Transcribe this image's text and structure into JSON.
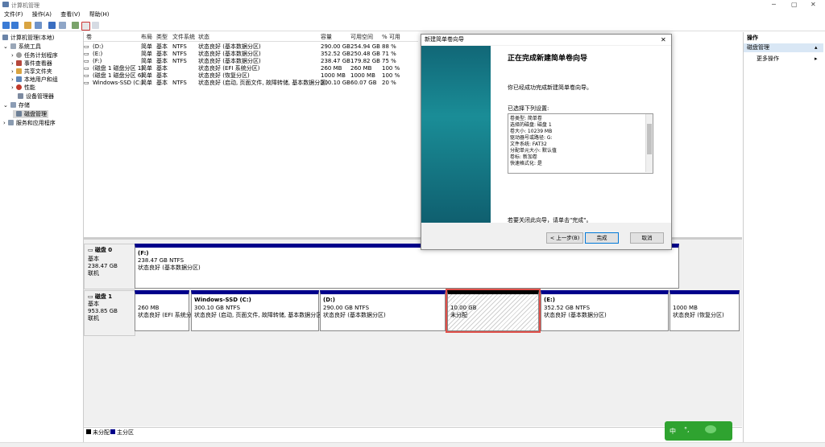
{
  "window": {
    "title": "计算机管理",
    "minimize": "─",
    "maximize": "▢",
    "close": "✕"
  },
  "menu": [
    "文件(F)",
    "操作(A)",
    "查看(V)",
    "帮助(H)"
  ],
  "tree": {
    "root": "计算机管理(本地)",
    "system_tools": "系统工具",
    "task_scheduler": "任务计划程序",
    "event_viewer": "事件查看器",
    "shared_folders": "共享文件夹",
    "local_users": "本地用户和组",
    "performance": "性能",
    "device_manager": "设备管理器",
    "storage": "存储",
    "disk_management": "磁盘管理",
    "services": "服务和应用程序"
  },
  "columns": [
    "卷",
    "布局",
    "类型",
    "文件系统",
    "状态",
    "容量",
    "可用空间",
    "% 可用"
  ],
  "volumes": [
    {
      "name": "(D:)",
      "layout": "简单",
      "type": "基本",
      "fs": "NTFS",
      "status": "状态良好 (基本数据分区)",
      "capacity": "290.00 GB",
      "free": "254.94 GB",
      "pct": "88 %"
    },
    {
      "name": "(E:)",
      "layout": "简单",
      "type": "基本",
      "fs": "NTFS",
      "status": "状态良好 (基本数据分区)",
      "capacity": "352.52 GB",
      "free": "250.48 GB",
      "pct": "71 %"
    },
    {
      "name": "(F:)",
      "layout": "简单",
      "type": "基本",
      "fs": "NTFS",
      "status": "状态良好 (基本数据分区)",
      "capacity": "238.47 GB",
      "free": "179.82 GB",
      "pct": "75 %"
    },
    {
      "name": "(磁盘 1 磁盘分区 1)",
      "layout": "简单",
      "type": "基本",
      "fs": "",
      "status": "状态良好 (EFI 系统分区)",
      "capacity": "260 MB",
      "free": "260 MB",
      "pct": "100 %"
    },
    {
      "name": "(磁盘 1 磁盘分区 6)",
      "layout": "简单",
      "type": "基本",
      "fs": "",
      "status": "状态良好 (恢复分区)",
      "capacity": "1000 MB",
      "free": "1000 MB",
      "pct": "100 %"
    },
    {
      "name": "Windows-SSD (C:)",
      "layout": "简单",
      "type": "基本",
      "fs": "NTFS",
      "status": "状态良好 (启动, 页面文件, 故障转储, 基本数据分区)",
      "capacity": "300.10 GB",
      "free": "60.07 GB",
      "pct": "20 %"
    }
  ],
  "disk0": {
    "name": "磁盘 0",
    "type": "基本",
    "size": "238.47 GB",
    "state": "联机",
    "part": {
      "name": "(F:)",
      "size": "238.47 GB NTFS",
      "status": "状态良好 (基本数据分区)"
    }
  },
  "disk1": {
    "name": "磁盘 1",
    "type": "基本",
    "size": "953.85 GB",
    "state": "联机",
    "parts": [
      {
        "name": "",
        "size": "260 MB",
        "status": "状态良好 (EFI 系统分)"
      },
      {
        "name": "Windows-SSD  (C:)",
        "size": "300.10 GB NTFS",
        "status": "状态良好 (启动, 页面文件, 故障转储, 基本数据分区)"
      },
      {
        "name": "(D:)",
        "size": "290.00 GB NTFS",
        "status": "状态良好 (基本数据分区)"
      },
      {
        "name": "",
        "size": "10.00 GB",
        "status": "未分配"
      },
      {
        "name": "(E:)",
        "size": "352.52 GB NTFS",
        "status": "状态良好 (基本数据分区)"
      },
      {
        "name": "",
        "size": "1000 MB",
        "status": "状态良好 (恢复分区)"
      }
    ]
  },
  "legend": {
    "unallocated": "未分配",
    "primary": "主分区"
  },
  "actions": {
    "header": "操作",
    "selected": "磁盘管理",
    "more": "更多操作"
  },
  "dialog": {
    "title": "新建简单卷向导",
    "heading": "正在完成新建简单卷向导",
    "intro": "你已经成功完成新建简单卷向导。",
    "selected_label": "已选择下列设置:",
    "settings": [
      "卷类型: 简单卷",
      "选择的磁盘: 磁盘 1",
      "卷大小: 10239 MB",
      "驱动器号或路径: G:",
      "文件系统: FAT32",
      "分配单元大小: 默认值",
      "卷标: 新加卷",
      "快速格式化: 是"
    ],
    "close_hint": "若要关闭此向导，请单击\"完成\"。",
    "back": "< 上一步(B)",
    "finish": "完成",
    "cancel": "取消"
  },
  "ime": {
    "lang": "中"
  },
  "colors": {
    "primary_partition": "#00008b",
    "unallocated": "#000000",
    "selection": "#e0504a",
    "wizard_side": "#1a8d97",
    "ime": "#2fa330"
  }
}
